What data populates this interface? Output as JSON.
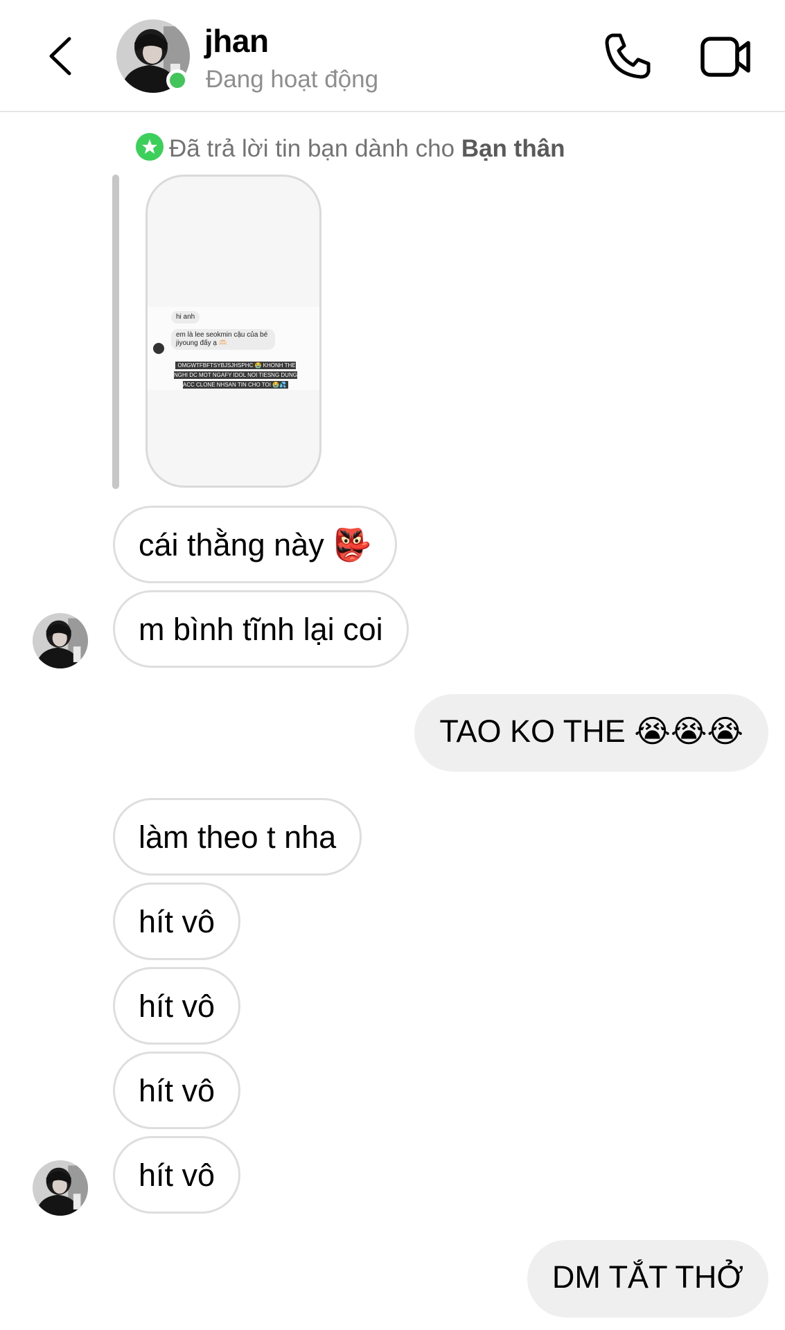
{
  "header": {
    "name": "jhan",
    "status": "Đang hoạt động"
  },
  "story_reply": {
    "note_prefix": "Đã trả lời tin bạn dành cho ",
    "note_audience": "Bạn thân",
    "thumb": {
      "line1": "hi anh",
      "line2": "em là lee seokmin cậu của bé jiyoung đấy ạ 🫶🏻",
      "caption": "OMGWTFBFTSYBJSJHSPHC 😭 KHONH THE NGHI DC MOT NGAFY IDOL NOI TIESNG DUNG ACC CLONE NHSAN TIN CHO TOI 😭💦"
    }
  },
  "messages": [
    {
      "side": "in",
      "text": "cái thằng này 👺"
    },
    {
      "side": "in",
      "text": "m bình tĩnh lại coi"
    },
    {
      "side": "out",
      "text": "TAO KO THE 😭😭😭"
    },
    {
      "side": "in",
      "text": "làm theo t nha"
    },
    {
      "side": "in",
      "text": "hít vô"
    },
    {
      "side": "in",
      "text": "hít vô"
    },
    {
      "side": "in",
      "text": "hít vô"
    },
    {
      "side": "in",
      "text": "hít vô"
    },
    {
      "side": "out",
      "text": "DM TẮT THỞ"
    }
  ],
  "colors": {
    "online": "#44c55c",
    "close_friends": "#3ccf5a",
    "incoming_border": "#dedede",
    "outgoing_bg": "#efefef"
  },
  "icons": [
    "back-icon",
    "phone-icon",
    "video-camera-icon",
    "star-icon"
  ]
}
